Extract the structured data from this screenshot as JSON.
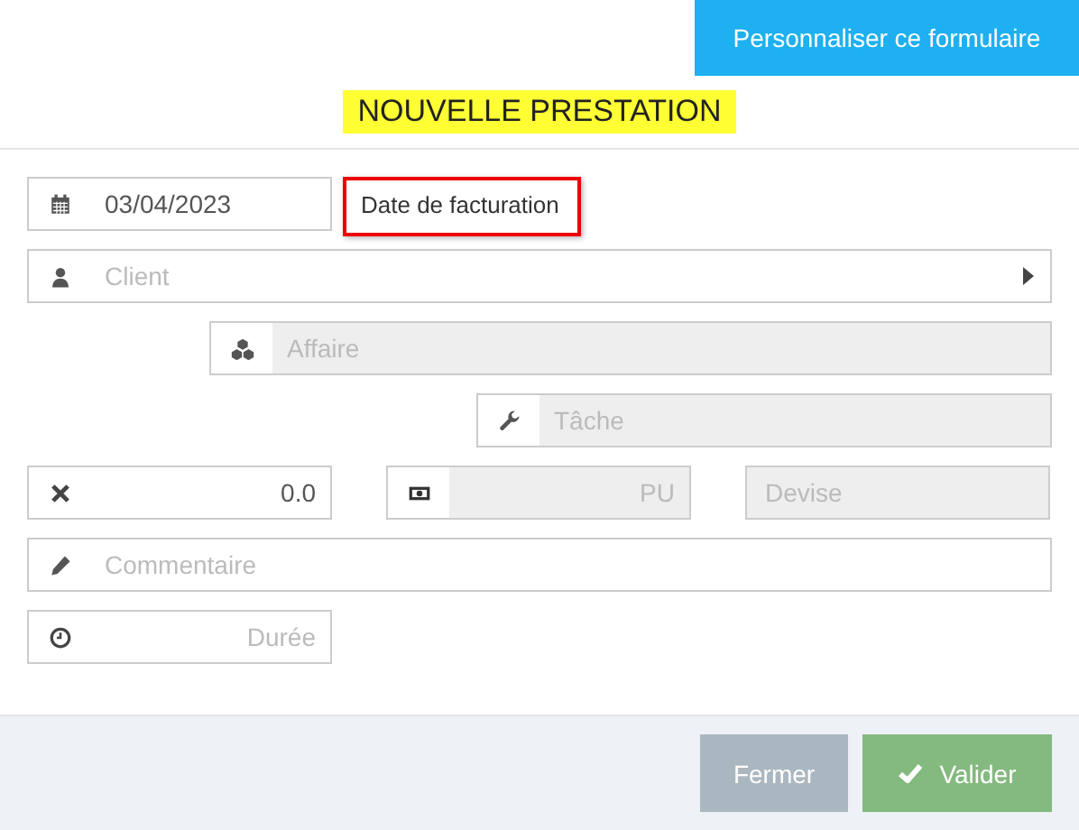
{
  "customize_button": "Personnaliser ce formulaire",
  "title": "NOUVELLE PRESTATION",
  "date_field": {
    "value": "03/04/2023",
    "disabled": false
  },
  "date_label": "Date de facturation",
  "client_field": {
    "placeholder": "Client",
    "disabled": false
  },
  "affaire_field": {
    "placeholder": "Affaire",
    "disabled": true
  },
  "tache_field": {
    "placeholder": "Tâche",
    "disabled": true
  },
  "quantity_field": {
    "value": "0.0",
    "disabled": false
  },
  "pu_field": {
    "placeholder": "PU",
    "disabled": true
  },
  "devise_field": {
    "placeholder": "Devise",
    "disabled": true
  },
  "comment_field": {
    "placeholder": "Commentaire",
    "disabled": false
  },
  "duration_field": {
    "placeholder": "Durée",
    "disabled": false
  },
  "buttons": [
    {
      "label": "Fermer",
      "kind": "secondary"
    },
    {
      "label": "Valider",
      "kind": "primary"
    }
  ]
}
